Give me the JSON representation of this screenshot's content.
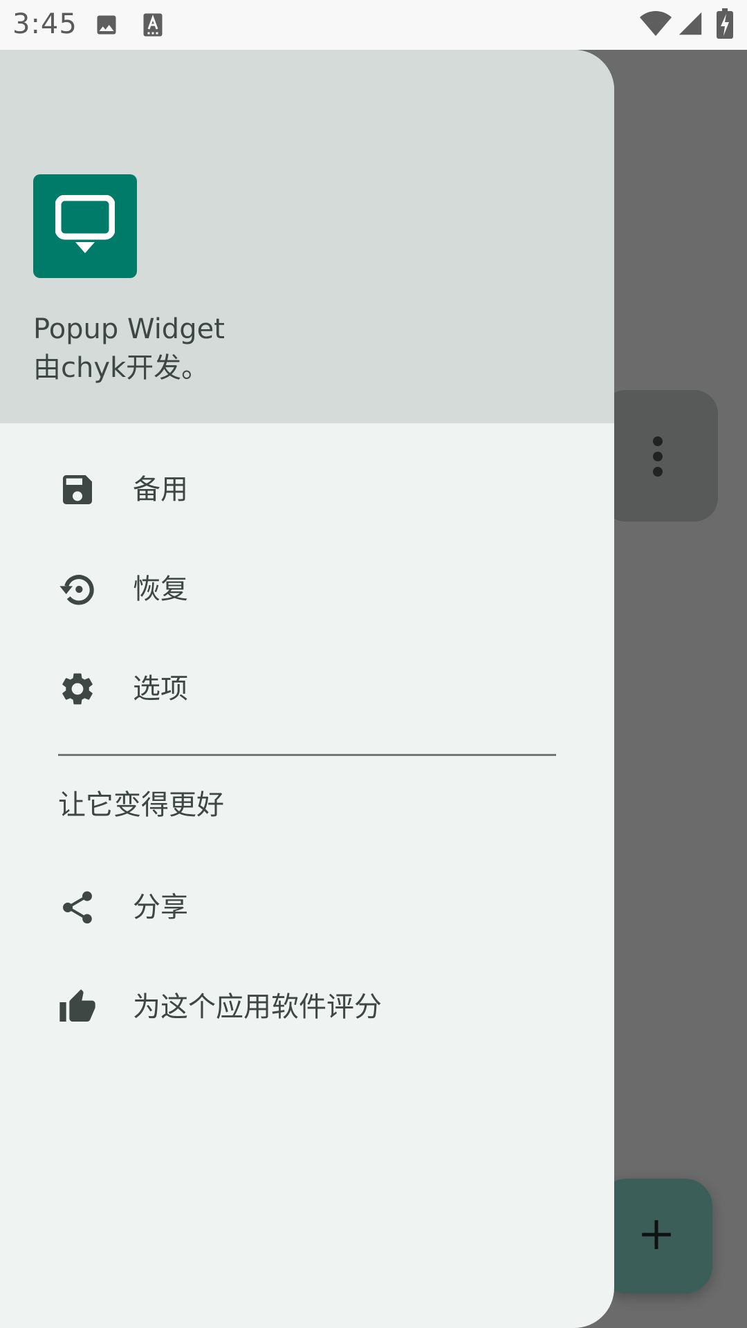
{
  "status_bar": {
    "time": "3:45",
    "icons": [
      "image-icon",
      "text-a-icon",
      "wifi-icon",
      "cell-signal-icon",
      "battery-charging-icon"
    ]
  },
  "drawer": {
    "header": {
      "app_name": "Popup Widget",
      "developer": "由chyk开发。",
      "logo_icon": "monitor-pin-icon",
      "logo_color": "#007b69"
    },
    "items": [
      {
        "label": "备用",
        "icon": "save-icon"
      },
      {
        "label": "恢复",
        "icon": "restore-icon"
      },
      {
        "label": "选项",
        "icon": "settings-icon"
      }
    ],
    "section_title": "让它变得更好",
    "section_items": [
      {
        "label": "分享",
        "icon": "share-icon"
      },
      {
        "label": "为这个应用软件评分",
        "icon": "thumb-up-icon"
      }
    ]
  },
  "background": {
    "more_icon": "more-vertical-icon",
    "fab_icon": "plus-icon",
    "fab_color": "#3c5e59"
  }
}
